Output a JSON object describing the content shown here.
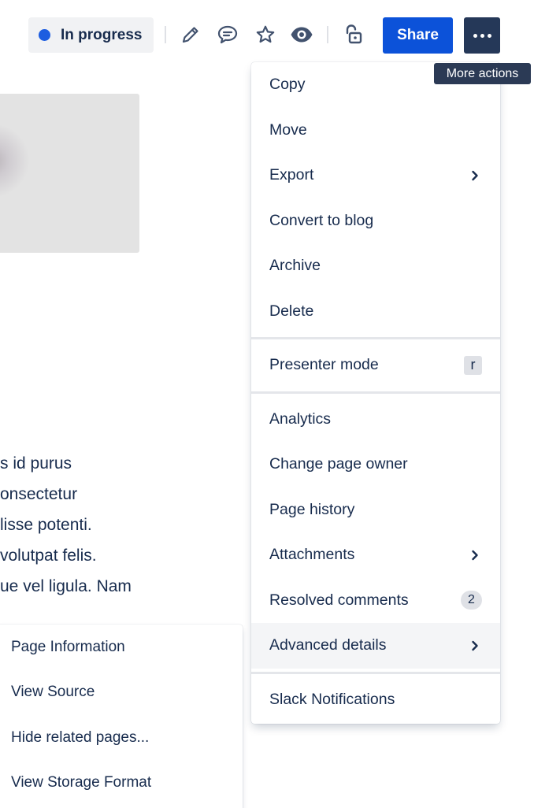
{
  "toolbar": {
    "status": {
      "label": "In progress",
      "dot_color": "#1d5de0"
    },
    "icons": [
      "edit-icon",
      "comment-icon",
      "star-icon",
      "watch-icon",
      "restrictions-icon"
    ],
    "share_label": "Share",
    "more_actions_tooltip": "More actions"
  },
  "content": {
    "text_lines": [
      "s id purus",
      "onsectetur",
      "lisse potenti.",
      " volutpat felis.",
      "ue vel ligula. Nam"
    ]
  },
  "sub_menu": {
    "items": [
      "Page Information",
      "View Source",
      "Hide related pages...",
      "View Storage Format"
    ]
  },
  "dropdown": {
    "groups": [
      {
        "items": [
          {
            "label": "Copy"
          },
          {
            "label": "Move"
          },
          {
            "label": "Export",
            "submenu": true
          },
          {
            "label": "Convert to blog"
          },
          {
            "label": "Archive"
          },
          {
            "label": "Delete"
          }
        ]
      },
      {
        "items": [
          {
            "label": "Presenter mode",
            "shortcut": "r"
          }
        ]
      },
      {
        "items": [
          {
            "label": "Analytics"
          },
          {
            "label": "Change page owner"
          },
          {
            "label": "Page history"
          },
          {
            "label": "Attachments",
            "submenu": true
          },
          {
            "label": "Resolved comments",
            "count": "2"
          },
          {
            "label": "Advanced details",
            "submenu": true,
            "highlighted": true
          }
        ]
      },
      {
        "items": [
          {
            "label": "Slack Notifications"
          }
        ]
      }
    ]
  }
}
